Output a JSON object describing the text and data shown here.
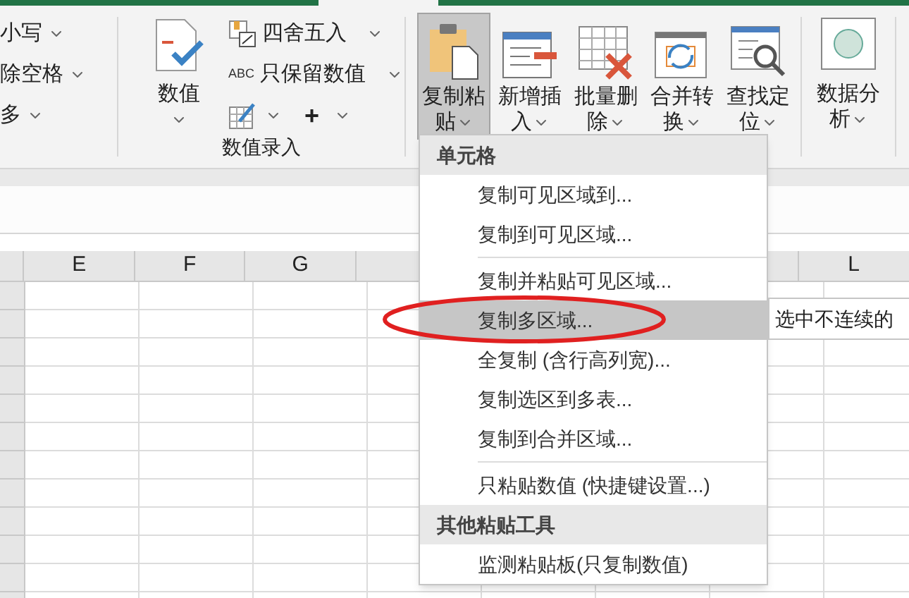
{
  "ribbon": {
    "left_group": {
      "items": [
        {
          "label": "小写"
        },
        {
          "label": "除空格"
        },
        {
          "label": "多"
        }
      ]
    },
    "number_group": {
      "big_button": {
        "label": "数值"
      },
      "small_buttons": [
        {
          "kind": "round",
          "label": "四舍五入"
        },
        {
          "kind": "abc",
          "icon_text": "ABC",
          "label": "只保留数值"
        }
      ],
      "icon_buttons": [
        {
          "kind": "table-edit"
        },
        {
          "kind": "plus",
          "label": "+"
        }
      ],
      "label": "数值录入"
    },
    "tools": [
      {
        "kind": "paste",
        "lines": [
          "复制粘",
          "贴"
        ],
        "selected": true
      },
      {
        "kind": "insert",
        "lines": [
          "新增插",
          "入"
        ],
        "selected": false
      },
      {
        "kind": "delete",
        "lines": [
          "批量删",
          "除"
        ],
        "selected": false
      },
      {
        "kind": "convert",
        "lines": [
          "合并转",
          "换"
        ],
        "selected": false
      },
      {
        "kind": "find",
        "lines": [
          "查找定",
          "位"
        ],
        "selected": false
      }
    ],
    "analysis": {
      "lines": [
        "数据分",
        "析"
      ]
    }
  },
  "spreadsheet": {
    "columns": [
      "E",
      "F",
      "G",
      "L"
    ]
  },
  "dropdown_menu": {
    "sections": [
      {
        "header": "单元格",
        "items": [
          {
            "label": "复制可见区域到...",
            "selected": false,
            "separator_before": false
          },
          {
            "label": "复制到可见区域...",
            "selected": false,
            "separator_before": false
          },
          {
            "label": "复制并粘贴可见区域...",
            "selected": false,
            "separator_before": true
          },
          {
            "label": "复制多区域...",
            "selected": true,
            "separator_before": false
          },
          {
            "label": "全复制 (含行高列宽)...",
            "selected": false,
            "separator_before": false
          },
          {
            "label": "复制选区到多表...",
            "selected": false,
            "separator_before": false
          },
          {
            "label": "复制到合并区域...",
            "selected": false,
            "separator_before": false
          },
          {
            "label": "只粘贴数值 (快捷键设置...)",
            "selected": false,
            "separator_before": true
          }
        ]
      },
      {
        "header": "其他粘贴工具",
        "items": [
          {
            "label": "监测粘贴板(只复制数值)",
            "selected": false,
            "separator_before": false
          }
        ]
      }
    ]
  },
  "tooltip": {
    "text": "选中不连续的"
  }
}
